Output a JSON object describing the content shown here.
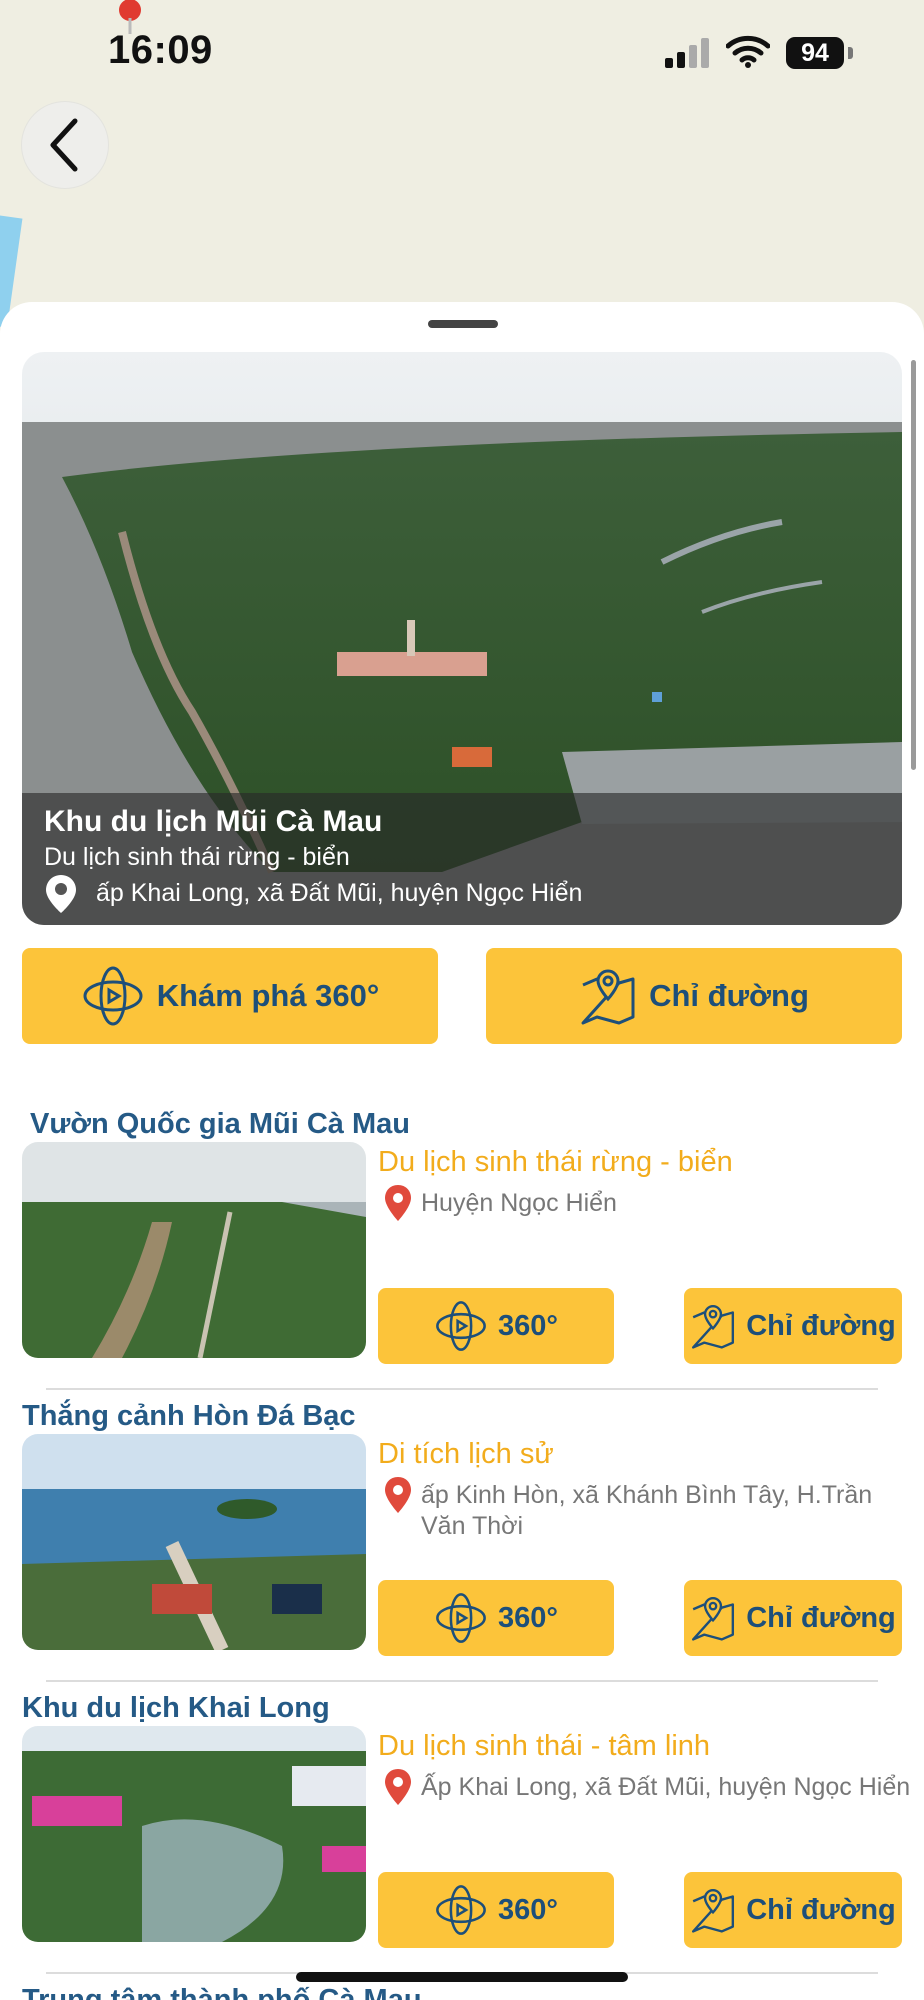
{
  "status_bar": {
    "time": "16:09",
    "battery": "94"
  },
  "featured": {
    "title": "Khu du lịch Mũi Cà Mau",
    "category": "Du lịch sinh thái rừng - biển",
    "address": "ấp Khai Long, xã Đất Mũi, huyện Ngọc Hiển",
    "explore_label": "Khám phá 360°",
    "directions_label": "Chỉ đường"
  },
  "places": [
    {
      "title": "Vườn Quốc gia Mũi Cà Mau",
      "category": "Du lịch sinh thái rừng - biển",
      "address": "Huyện Ngọc Hiển",
      "btn360": "360°",
      "directions": "Chỉ đường"
    },
    {
      "title": "Thắng cảnh Hòn Đá Bạc",
      "category": "Di tích lịch sử",
      "address": "ấp Kinh Hòn, xã Khánh Bình Tây, H.Trần Văn Thời",
      "btn360": "360°",
      "directions": "Chỉ đường"
    },
    {
      "title": "Khu du lịch Khai Long",
      "category": "Du lịch sinh thái - tâm linh",
      "address": "Ấp Khai Long, xã Đất Mũi, huyện Ngọc Hiển",
      "btn360": "360°",
      "directions": "Chỉ đường"
    },
    {
      "title": "Trung tâm thành phố Cà Mau"
    }
  ],
  "colors": {
    "accent": "#fcc43a",
    "title_blue": "#255a86",
    "category_orange": "#f2ac1c",
    "pin_red": "#e04a3c"
  },
  "icons": [
    "chevron-left-icon",
    "location-pin-icon",
    "360-view-icon",
    "map-icon"
  ]
}
